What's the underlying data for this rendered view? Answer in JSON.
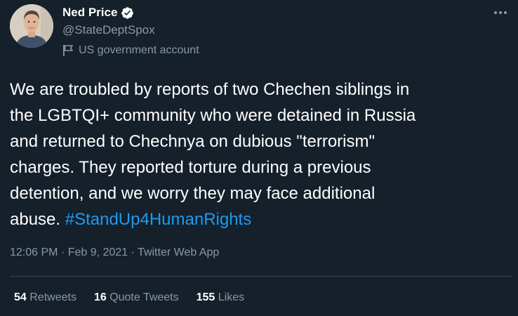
{
  "author": {
    "display_name": "Ned Price",
    "handle": "@StateDeptSpox",
    "verified_icon": "verified-badge-icon",
    "account_label": "US government account",
    "account_label_icon": "flag-icon"
  },
  "tweet": {
    "lines": [
      "We are troubled by reports of two Chechen siblings in",
      "the LGBTQI+ community who were detained in Russia",
      "and returned to Chechnya on dubious \"terrorism\"",
      "charges. They reported torture during a previous",
      "detention, and we worry they may face additional"
    ],
    "last_line_text": "abuse. ",
    "hashtag": "#StandUp4HumanRights"
  },
  "meta": {
    "time": "12:06 PM",
    "separator": " · ",
    "date": "Feb 9, 2021",
    "source": "Twitter Web App"
  },
  "stats": {
    "retweets_count": "54",
    "retweets_label": " Retweets",
    "quote_tweets_count": "16",
    "quote_tweets_label": " Quote Tweets",
    "likes_count": "155",
    "likes_label": " Likes"
  },
  "menu": {
    "icon": "more-horizontal-icon"
  },
  "colors": {
    "background": "#15202b",
    "text": "#ffffff",
    "secondary_text": "#8899a6",
    "link": "#1d9bf0",
    "divider": "#38444d"
  }
}
